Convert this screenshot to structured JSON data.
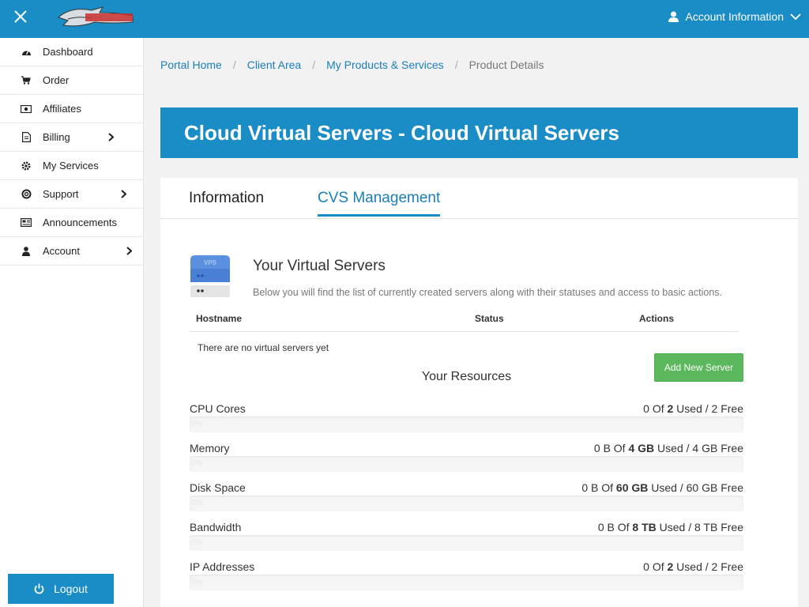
{
  "header": {
    "account_label": "Account Information"
  },
  "sidebar": {
    "items": [
      {
        "label": "Dashboard"
      },
      {
        "label": "Order"
      },
      {
        "label": "Affiliates"
      },
      {
        "label": "Billing"
      },
      {
        "label": "My Services"
      },
      {
        "label": "Support"
      },
      {
        "label": "Announcements"
      },
      {
        "label": "Account"
      }
    ],
    "logout_label": "Logout"
  },
  "breadcrumb": {
    "items": [
      "Portal Home",
      "Client Area",
      "My Products & Services"
    ],
    "current": "Product Details"
  },
  "page": {
    "title": "Cloud Virtual Servers - Cloud Virtual Servers"
  },
  "tabs": {
    "information": "Information",
    "cvs_management": "CVS Management"
  },
  "servers": {
    "icon_label": "VPS",
    "title": "Your Virtual Servers",
    "description": "Below you will find the list of currently created servers along with their statuses and access to basic actions.",
    "columns": [
      "Hostname",
      "Status",
      "Actions"
    ],
    "empty_text": "There are no virtual servers yet",
    "add_button": "Add New Server"
  },
  "resources": {
    "title": "Your Resources",
    "items": [
      {
        "label": "CPU Cores",
        "used": "0",
        "of_word": "Of",
        "total": "2",
        "used_word": "Used",
        "free": "2 Free",
        "percent": 0,
        "bar_text": "0%"
      },
      {
        "label": "Memory",
        "used": "0 B",
        "of_word": "Of",
        "total": "4 GB",
        "used_word": "Used",
        "free": "4 GB Free",
        "percent": 0,
        "bar_text": "0%"
      },
      {
        "label": "Disk Space",
        "used": "0 B",
        "of_word": "Of",
        "total": "60 GB",
        "used_word": "Used",
        "free": "60 GB Free",
        "percent": 0,
        "bar_text": "0%"
      },
      {
        "label": "Bandwidth",
        "used": "0 B",
        "of_word": "Of",
        "total": "8 TB",
        "used_word": "Used",
        "free": "8 TB Free",
        "percent": 0,
        "bar_text": "0%"
      },
      {
        "label": "IP Addresses",
        "used": "0",
        "of_word": "Of",
        "total": "2",
        "used_word": "Used",
        "free": "2 Free",
        "percent": 0,
        "bar_text": "0%"
      }
    ]
  },
  "colors": {
    "primary": "#1a8cc6",
    "success": "#5cb85c"
  }
}
